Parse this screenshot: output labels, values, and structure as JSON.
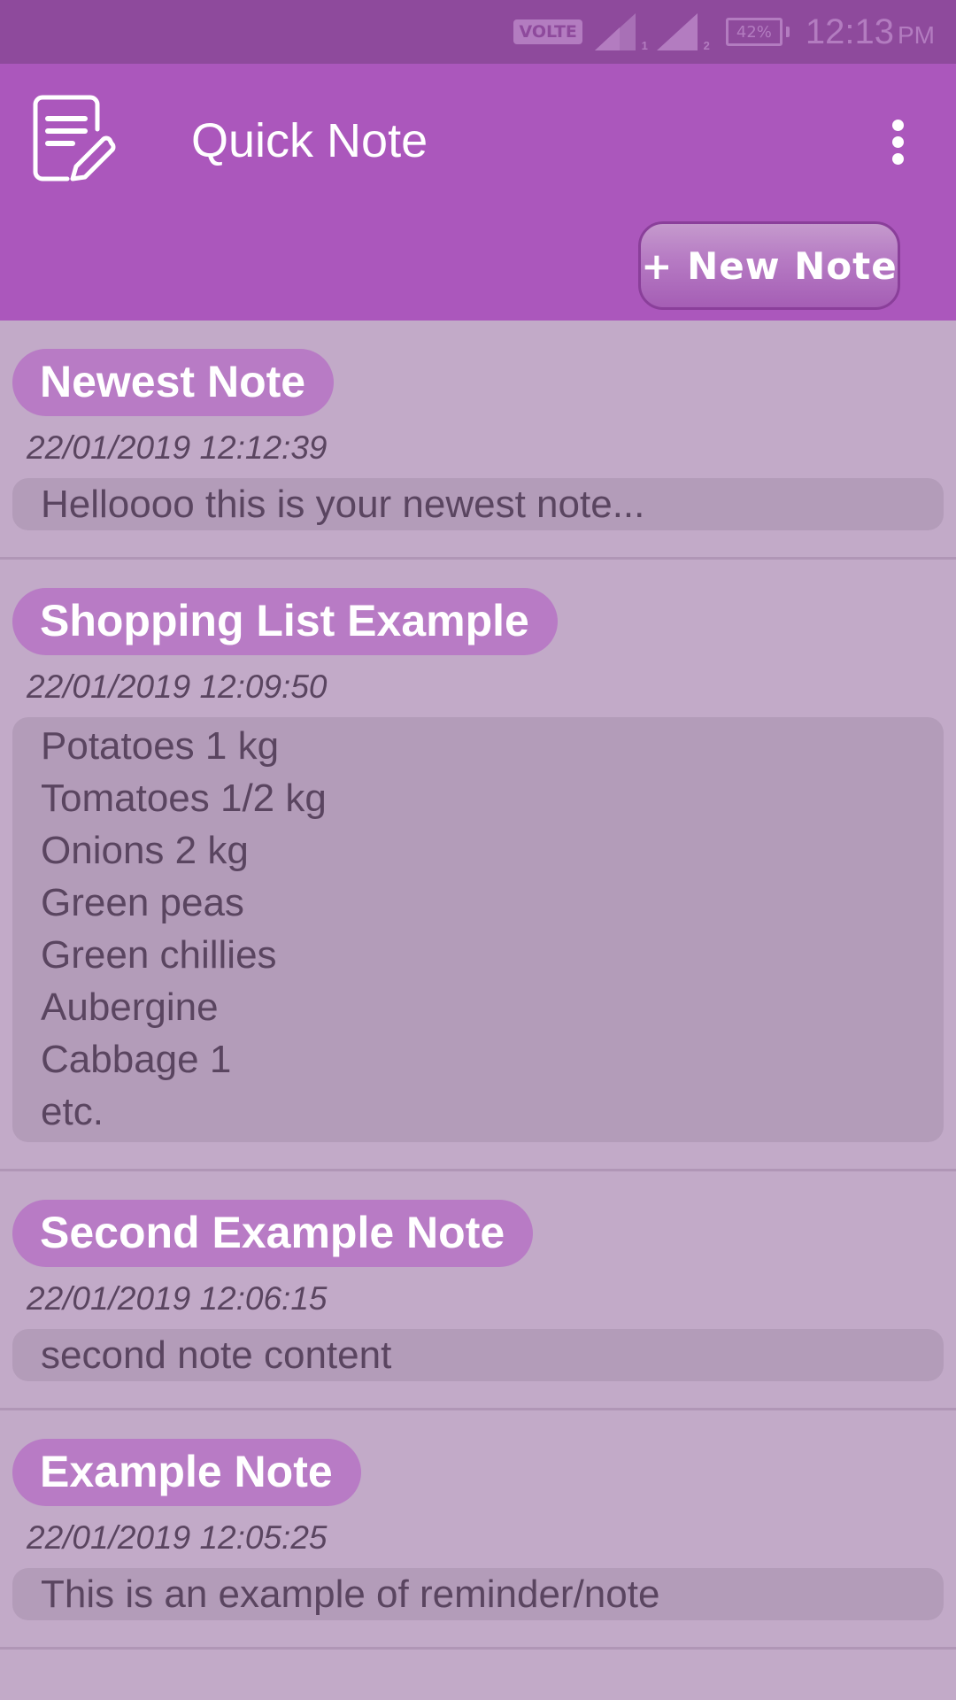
{
  "status_bar": {
    "volte": "VOLTE",
    "sim1": "1",
    "sim2": "2",
    "battery": "42%",
    "time": "12:13",
    "ampm": "PM"
  },
  "app_bar": {
    "title": "Quick Note",
    "app_icon": "note-edit-icon",
    "overflow_icon": "more-vert-icon",
    "new_note_label": "+ New Note"
  },
  "colors": {
    "status_bar": "#8e4a9c",
    "app_bar": "#ab57bc",
    "background": "#c2aac8",
    "title_pill": "#b87bc5",
    "note_body": "#b39cb9",
    "text_dark": "#5a4560"
  },
  "notes": [
    {
      "title": "Newest Note",
      "date": "22/01/2019 12:12:39",
      "body": "Helloooo this is your newest note..."
    },
    {
      "title": "Shopping List Example",
      "date": "22/01/2019 12:09:50",
      "body": "Potatoes 1 kg\nTomatoes 1/2 kg\nOnions 2 kg\nGreen peas\nGreen chillies\nAubergine\nCabbage 1\netc."
    },
    {
      "title": "Second Example Note",
      "date": "22/01/2019 12:06:15",
      "body": "second note content"
    },
    {
      "title": "Example Note",
      "date": "22/01/2019 12:05:25",
      "body": "This is an example of reminder/note"
    }
  ]
}
